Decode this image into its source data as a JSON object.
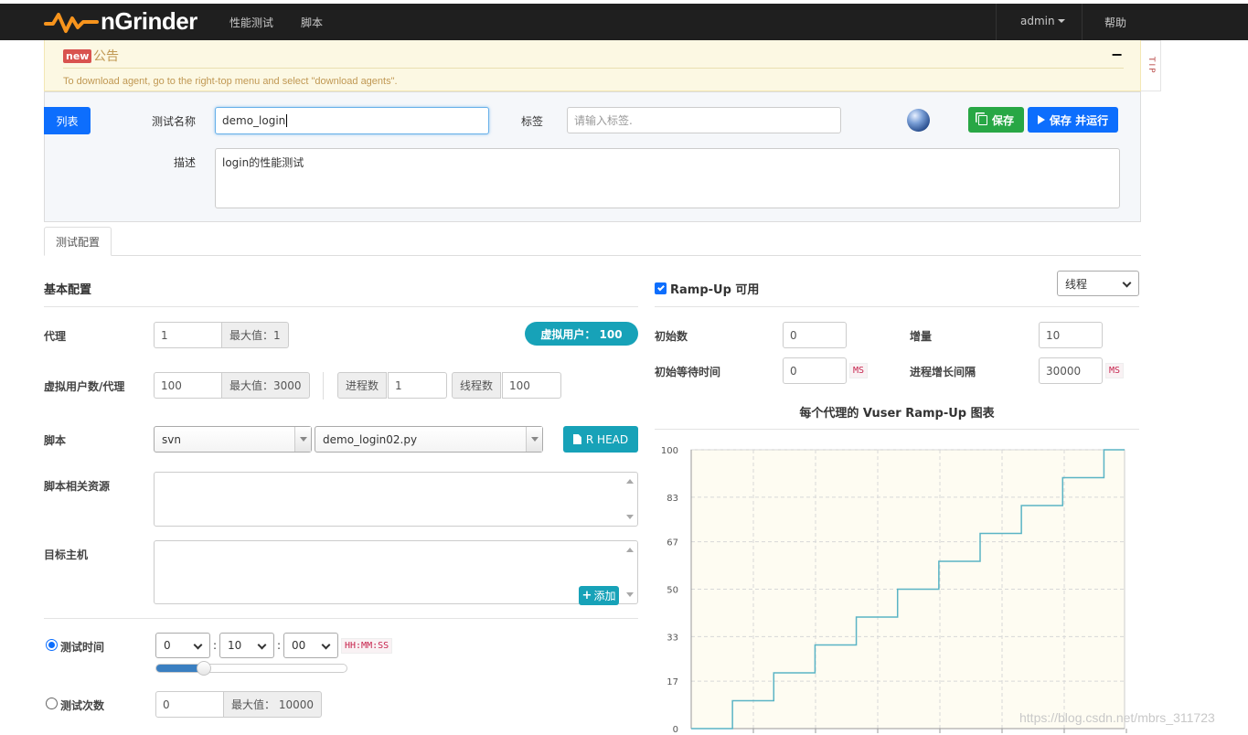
{
  "navbar": {
    "brand": "nGrinder",
    "links": [
      "性能测试",
      "脚本"
    ],
    "user": "admin",
    "help": "帮助"
  },
  "notice": {
    "badge": "new",
    "title": "公告",
    "collapse": "−",
    "message": "To download agent, go to the right-top menu and select \"download agents\".",
    "tip": "TIP"
  },
  "header": {
    "list_button": "列表",
    "test_name_label": "测试名称",
    "test_name_value": "demo_login",
    "tag_label": "标签",
    "tag_placeholder": "请输入标签.",
    "save_button": "保存",
    "save_run_button": "保存 并运行",
    "desc_label": "描述",
    "desc_value": "login的性能测试"
  },
  "tabs": [
    "测试配置"
  ],
  "basic": {
    "title": "基本配置",
    "agent_label": "代理",
    "agent_value": "1",
    "agent_max": "最大值：1",
    "vuser_badge": "虚拟用户：  100",
    "vuser_per_agent_label": "虚拟用户数/代理",
    "vuser_per_agent_value": "100",
    "vuser_max": "最大值：3000",
    "process_label": "进程数",
    "process_value": "1",
    "thread_label": "线程数",
    "thread_value": "100",
    "script_label": "脚本",
    "script_repo": "svn",
    "script_file": "demo_login02.py",
    "rhead_button": "R HEAD",
    "resources_label": "脚本相关资源",
    "target_host_label": "目标主机",
    "add_button": "添加",
    "duration_label": "测试时间",
    "duration_h": "0",
    "duration_m": "10",
    "duration_s": "00",
    "duration_format": "HH:MM:SS",
    "duration_slider_fraction": 0.25,
    "run_count_label": "测试次数",
    "run_count_value": "0",
    "run_count_max": "最大值：  10000"
  },
  "rampup": {
    "enabled_label": "Ramp-Up 可用",
    "enabled": true,
    "type_select": "线程",
    "initial_label": "初始数",
    "initial_value": "0",
    "increment_label": "增量",
    "increment_value": "10",
    "initial_wait_label": "初始等待时间",
    "initial_wait_value": "0",
    "initial_wait_unit": "MS",
    "interval_label": "进程增长间隔",
    "interval_value": "30000",
    "interval_unit": "MS",
    "chart_title": "每个代理的 Vuser Ramp-Up 图表"
  },
  "chart_data": {
    "type": "line",
    "title": "每个代理的 Vuser Ramp-Up 图表",
    "xlabel": "",
    "ylabel": "",
    "yticks": [
      "0",
      "17",
      "33",
      "50",
      "67",
      "83",
      "100"
    ],
    "ylim": [
      0,
      100
    ],
    "xlim": [
      0,
      10.5
    ],
    "grid": true,
    "series": [
      {
        "x": [
          0,
          1,
          1,
          2,
          2,
          3,
          3,
          4,
          4,
          5,
          5,
          6,
          6,
          7,
          7,
          8,
          8,
          9,
          9,
          10,
          10,
          10.5
        ],
        "y": [
          0,
          0,
          10,
          10,
          20,
          20,
          30,
          30,
          40,
          40,
          50,
          50,
          60,
          60,
          70,
          70,
          80,
          80,
          90,
          90,
          100,
          100
        ]
      }
    ],
    "line_color": "#5ab4c5"
  },
  "watermark": "https://blog.csdn.net/mbrs_311723"
}
